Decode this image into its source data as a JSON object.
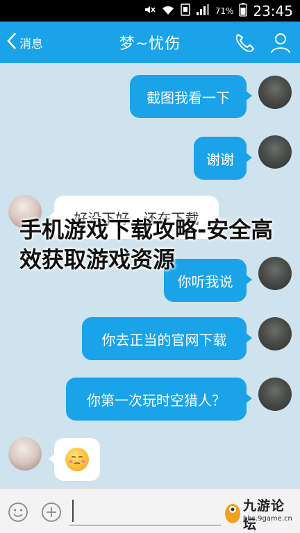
{
  "status_bar": {
    "battery_percent": "71%",
    "time": "23:45"
  },
  "header": {
    "back_label": "消息",
    "title": "梦~忧伤"
  },
  "messages": [
    {
      "from": "me",
      "text": "截图我看一下"
    },
    {
      "from": "me",
      "text": "谢谢"
    },
    {
      "from": "other",
      "text": "好没下好，还在下载"
    },
    {
      "from": "me",
      "text": "你听我说"
    },
    {
      "from": "me",
      "text": "你去正当的官网下载"
    },
    {
      "from": "me",
      "text": "你第一次玩时空猎人？"
    },
    {
      "from": "other",
      "emoji": "sleepy-face-icon"
    }
  ],
  "overlay": {
    "title": "手机游戏下载攻略-安全高效获取游戏资源"
  },
  "input": {
    "value": ""
  },
  "watermark": {
    "name": "九游论坛",
    "url": "bbs.9game.cn"
  },
  "colors": {
    "accent": "#1aa3e8",
    "chat_background": "#cfe3ee"
  }
}
